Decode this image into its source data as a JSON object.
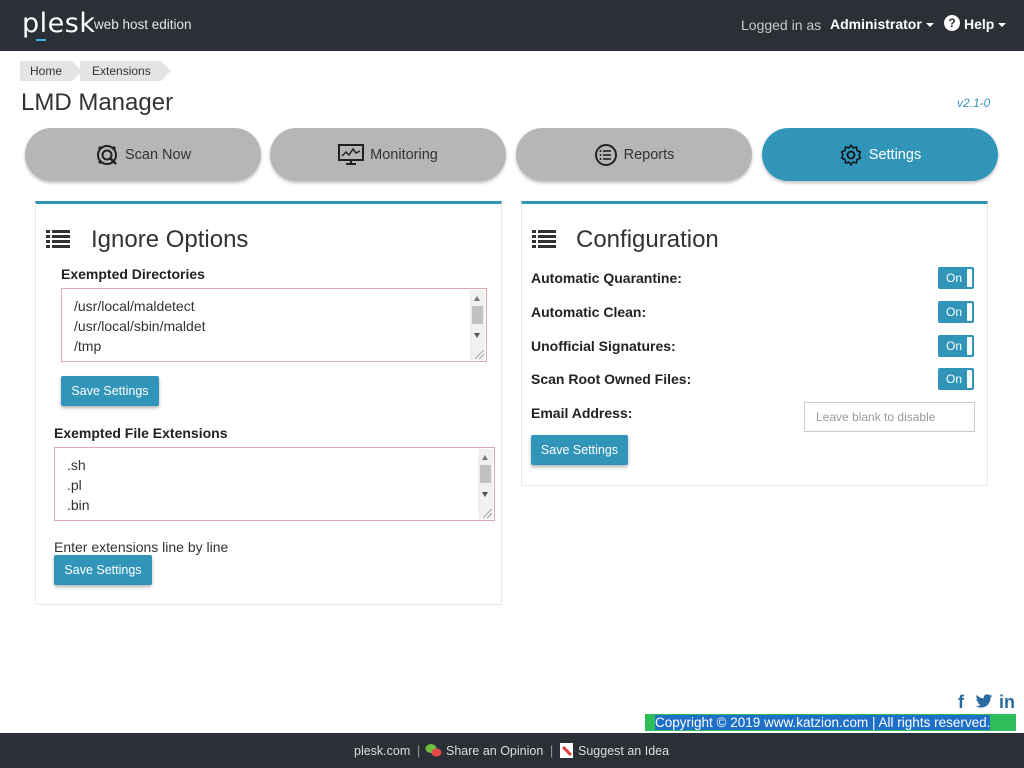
{
  "header": {
    "logo": "plesk",
    "edition": "web host edition",
    "logged_in_as": "Logged in as",
    "user": "Administrator",
    "help": "Help"
  },
  "breadcrumb": [
    "Home",
    "Extensions"
  ],
  "page": {
    "title": "LMD Manager",
    "version": "v2.1-0"
  },
  "nav": [
    {
      "label": "Scan Now",
      "icon": "scan-icon",
      "active": false
    },
    {
      "label": "Monitoring",
      "icon": "monitor-icon",
      "active": false
    },
    {
      "label": "Reports",
      "icon": "reports-icon",
      "active": false
    },
    {
      "label": "Settings",
      "icon": "gear-icon",
      "active": true
    }
  ],
  "ignore": {
    "title": "Ignore Options",
    "dirs_label": "Exempted Directories",
    "dirs": [
      "/usr/local/maldetect",
      "/usr/local/sbin/maldet",
      "/tmp"
    ],
    "ext_label": "Exempted File Extensions",
    "exts": [
      ".sh",
      ".pl",
      ".bin"
    ],
    "hint": "Enter extensions line by line",
    "save_label": "Save Settings"
  },
  "config": {
    "title": "Configuration",
    "options": [
      {
        "label": "Automatic Quarantine:",
        "state": "On"
      },
      {
        "label": "Automatic Clean:",
        "state": "On"
      },
      {
        "label": "Unofficial Signatures:",
        "state": "On"
      },
      {
        "label": "Scan Root Owned Files:",
        "state": "On"
      }
    ],
    "email_label": "Email Address:",
    "email_placeholder": "Leave blank to disable",
    "save_label": "Save Settings"
  },
  "footer": {
    "social": [
      "f",
      "twitter",
      "in"
    ],
    "copyright": "Copyright © 2019  www.katzion.com  | All rights reserved.",
    "links": [
      "plesk.com",
      "Share an Opinion",
      "Suggest an Idea"
    ]
  },
  "colors": {
    "accent": "#3195ba",
    "topbar": "#2b2f36",
    "inactive_tab": "#b6b6b6",
    "copyright_bg": "#2ebd59"
  }
}
